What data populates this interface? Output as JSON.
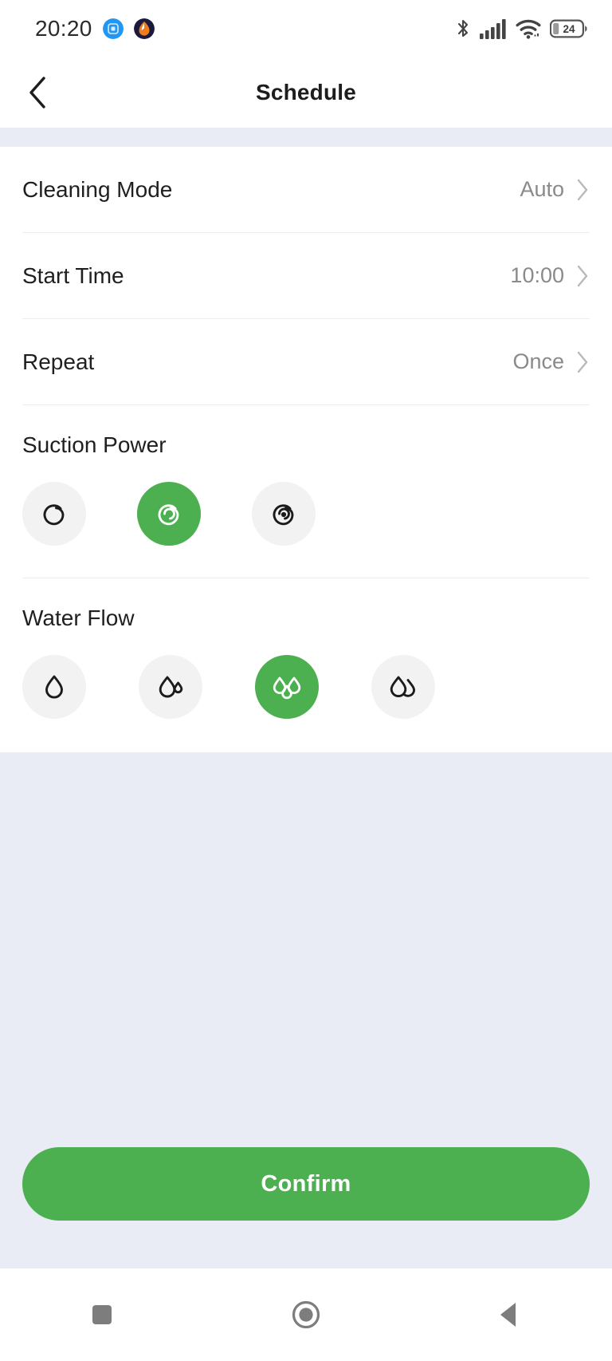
{
  "statusbar": {
    "time": "20:20",
    "app_icons": [
      {
        "name": "blue-app-icon",
        "color": "#2196f3"
      },
      {
        "name": "orange-app-icon",
        "color": "#1a1a3e"
      }
    ],
    "icons": [
      "bluetooth-icon",
      "cellular-signal-icon",
      "wifi-icon",
      "battery-icon"
    ],
    "battery_level": "24"
  },
  "appbar": {
    "title": "Schedule",
    "back_icon": "chevron-left-icon"
  },
  "rows": [
    {
      "label": "Cleaning Mode",
      "value": "Auto"
    },
    {
      "label": "Start Time",
      "value": "10:00"
    },
    {
      "label": "Repeat",
      "value": "Once"
    }
  ],
  "suction": {
    "title": "Suction Power",
    "selected_index": 1,
    "options": [
      {
        "icon": "suction-quiet-icon"
      },
      {
        "icon": "suction-standard-icon"
      },
      {
        "icon": "suction-turbo-icon"
      }
    ]
  },
  "water": {
    "title": "Water Flow",
    "selected_index": 2,
    "options": [
      {
        "icon": "water-low-icon"
      },
      {
        "icon": "water-medium-icon"
      },
      {
        "icon": "water-high-icon"
      },
      {
        "icon": "water-max-icon"
      }
    ]
  },
  "confirm": {
    "label": "Confirm"
  },
  "navbar": {
    "buttons": [
      {
        "icon": "recents-square-icon"
      },
      {
        "icon": "home-circle-icon"
      },
      {
        "icon": "back-triangle-icon"
      }
    ]
  },
  "colors": {
    "accent": "#4caf50",
    "page_bg": "#e9ecf5",
    "card_bg": "#ffffff",
    "text_primary": "#1f1f1f",
    "text_secondary": "#8a8a8a",
    "chip_bg": "#f2f2f2"
  }
}
